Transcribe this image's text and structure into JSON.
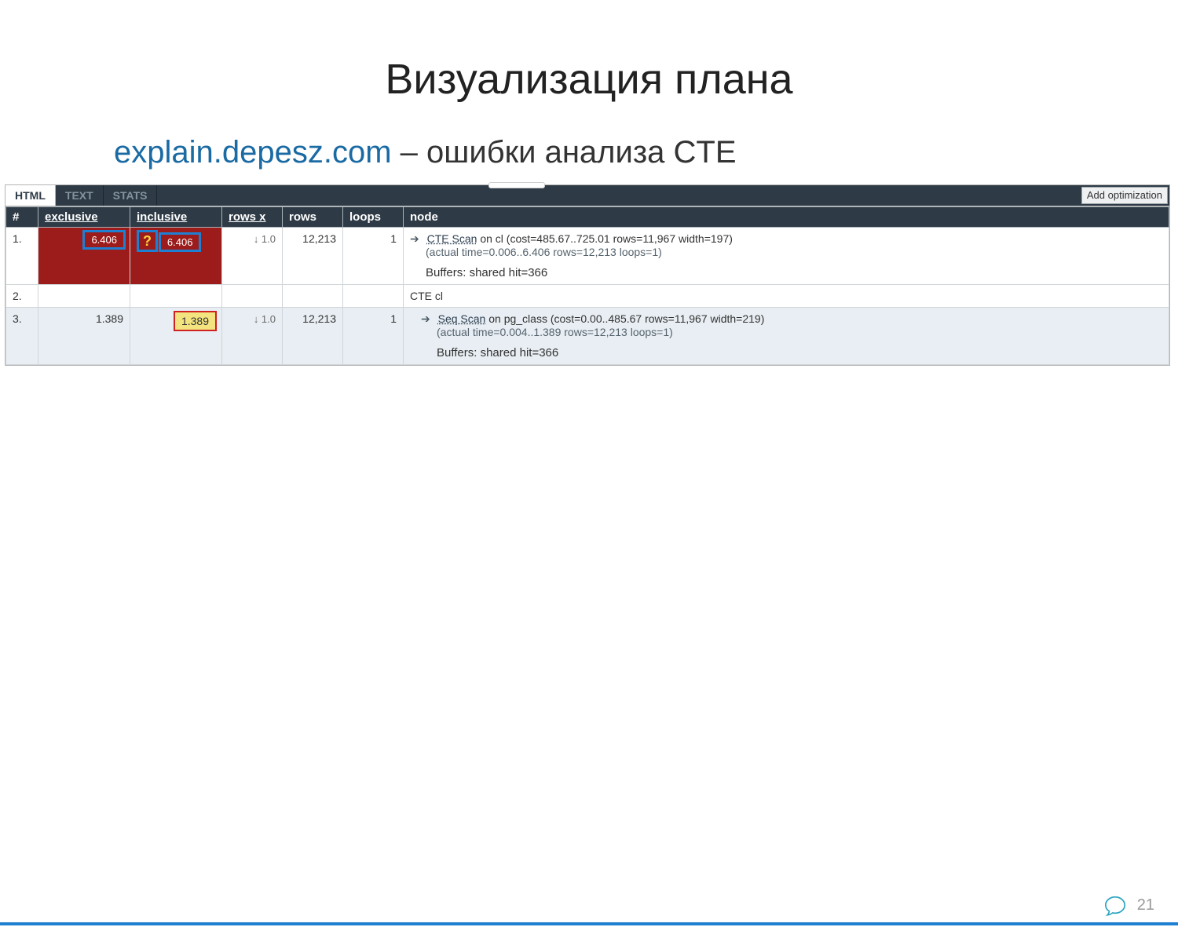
{
  "slide": {
    "title": "Визуализация плана",
    "page_number": "21"
  },
  "subtitle": {
    "link": "explain.depesz.com",
    "rest": " – ошибки анализа CTE"
  },
  "tabs": {
    "html": "HTML",
    "text": "TEXT",
    "stats": "STATS",
    "add_opt": "Add optimization"
  },
  "headers": {
    "idx": "#",
    "exclusive": "exclusive",
    "inclusive": "inclusive",
    "rowsx": "rows x",
    "rows": "rows",
    "loops": "loops",
    "node": "node"
  },
  "rows": [
    {
      "idx": "1.",
      "exclusive_badge": "6.406",
      "qmark": "?",
      "inclusive_badge": "6.406",
      "rowsx": "↓ 1.0",
      "rows": "12,213",
      "loops": "1",
      "scan_label": "CTE Scan",
      "scan_rest": " on cl (cost=485.67..725.01 rows=11,967 width=197)",
      "actual": "(actual time=0.006..6.406 rows=12,213 loops=1)",
      "buffers": "Buffers: shared hit=366"
    },
    {
      "idx": "2.",
      "node_plain": "CTE cl"
    },
    {
      "idx": "3.",
      "exclusive": "1.389",
      "inclusive_yellow": "1.389",
      "rowsx": "↓ 1.0",
      "rows": "12,213",
      "loops": "1",
      "scan_label": "Seq Scan",
      "scan_rest": " on pg_class (cost=0.00..485.67 rows=11,967 width=219)",
      "actual": "(actual time=0.004..1.389 rows=12,213 loops=1)",
      "buffers": "Buffers: shared hit=366"
    }
  ]
}
